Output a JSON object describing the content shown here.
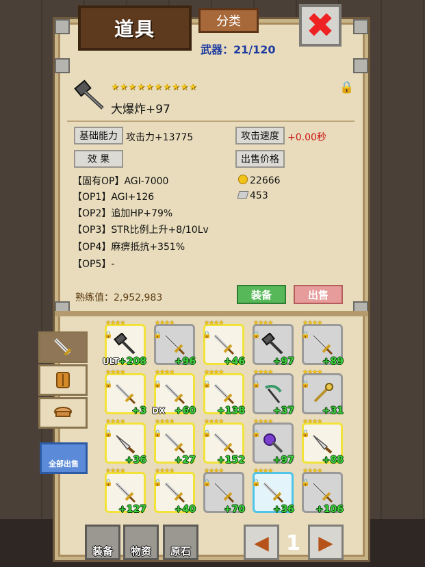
{
  "header": {
    "title": "道具",
    "category_label": "分类",
    "close_icon": "close-x-icon",
    "weapon_count_label": "武器：21/120"
  },
  "item": {
    "name": "大爆炸+97",
    "stars": "★★★★★★★★★★",
    "base_label": "基础能力",
    "attack_value": "攻击力+13775",
    "speed_label": "攻击速度",
    "speed_value": "+0.00秒",
    "effect_label": "效 果",
    "sell_label": "出售价格",
    "options": [
      "【固有OP】AGI-7000",
      "【OP1】AGI+126",
      "【OP2】追加HP+79%",
      "【OP3】STR比例上升+8/10Lv",
      "【OP4】麻痹抵抗+351%",
      "【OP5】-"
    ],
    "gold_price": "22666",
    "ore_price": "453",
    "proficiency": "熟练值：2,952,983",
    "equip_label": "装备",
    "sell_button_label": "出售"
  },
  "inventory": {
    "slots": [
      {
        "level": "+208",
        "tag": "ULT",
        "frame": "gold",
        "icon": "hammer-icon"
      },
      {
        "level": "+96",
        "tag": "",
        "frame": "gray",
        "icon": "sword-icon"
      },
      {
        "level": "+46",
        "tag": "",
        "frame": "gold",
        "icon": "sword-icon"
      },
      {
        "level": "+97",
        "tag": "",
        "frame": "gray",
        "icon": "hammer-icon"
      },
      {
        "level": "+89",
        "tag": "",
        "frame": "gray",
        "icon": "sword-icon"
      },
      {
        "level": "+3",
        "tag": "",
        "frame": "gold",
        "icon": "sword-icon"
      },
      {
        "level": "+60",
        "tag": "DX",
        "frame": "gold",
        "icon": "sword-icon"
      },
      {
        "level": "+138",
        "tag": "",
        "frame": "gold",
        "icon": "sword-icon"
      },
      {
        "level": "+37",
        "tag": "",
        "frame": "gray",
        "icon": "scythe-icon"
      },
      {
        "level": "+31",
        "tag": "",
        "frame": "gray",
        "icon": "staff-icon"
      },
      {
        "level": "+36",
        "tag": "",
        "frame": "gold",
        "icon": "knife-icon"
      },
      {
        "level": "+27",
        "tag": "",
        "frame": "gold",
        "icon": "sword-icon"
      },
      {
        "level": "+152",
        "tag": "",
        "frame": "gold",
        "icon": "sword-icon"
      },
      {
        "level": "+97",
        "tag": "",
        "frame": "gray",
        "icon": "mace-icon"
      },
      {
        "level": "+88",
        "tag": "",
        "frame": "gold",
        "icon": "knife-icon"
      },
      {
        "level": "+127",
        "tag": "",
        "frame": "gold",
        "icon": "sword-icon"
      },
      {
        "level": "+40",
        "tag": "",
        "frame": "gold",
        "icon": "sword-icon"
      },
      {
        "level": "+70",
        "tag": "",
        "frame": "gray",
        "icon": "sword-icon"
      },
      {
        "level": "+36",
        "tag": "",
        "frame": "blue",
        "icon": "sword-icon"
      },
      {
        "level": "+106",
        "tag": "",
        "frame": "gray",
        "icon": "sword-icon"
      }
    ],
    "sell_all_label": "全部出售"
  },
  "bottom": {
    "equip_label": "装备",
    "material_label": "物资",
    "ore_label": "原石",
    "page": "1"
  }
}
